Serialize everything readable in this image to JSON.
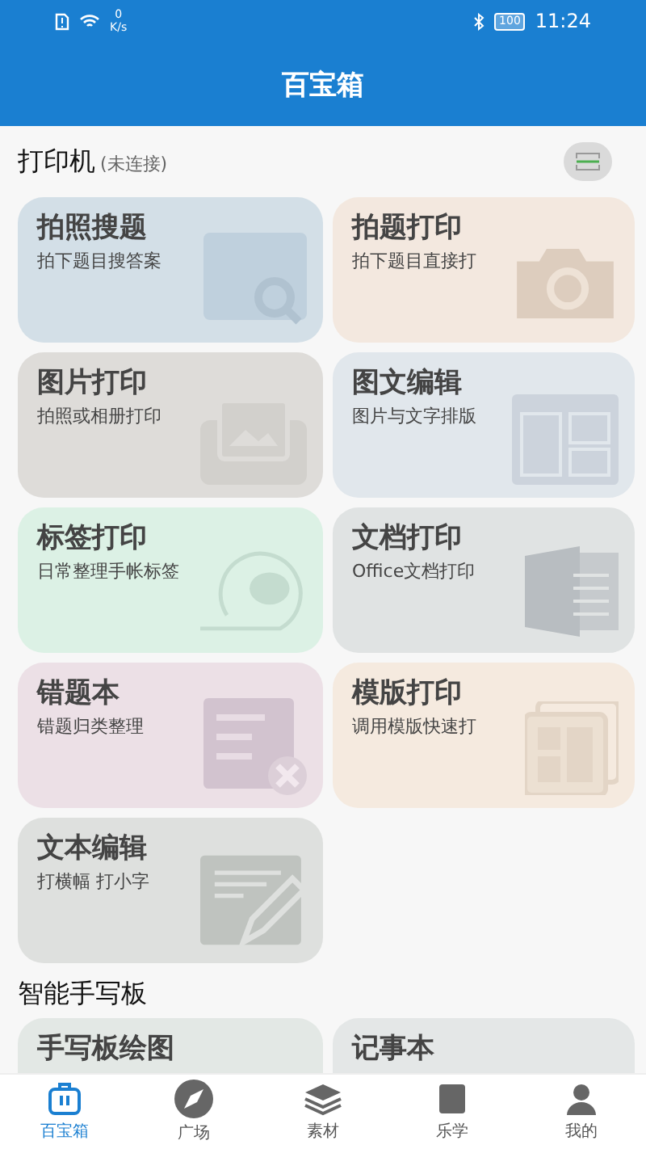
{
  "status_bar": {
    "speed_value": "0",
    "speed_unit": "K/s",
    "battery": "100",
    "time": "11:24"
  },
  "header": {
    "title": "百宝箱"
  },
  "sections": [
    {
      "title": "打印机",
      "note": "(未连接)",
      "has_printer_button": true,
      "cards": [
        {
          "title": "拍照搜题",
          "subtitle": "拍下题目搜答案",
          "color": "#d3dfe7"
        },
        {
          "title": "拍题打印",
          "subtitle": "拍下题目直接打",
          "color": "#f3e8df"
        },
        {
          "title": "图片打印",
          "subtitle": "拍照或相册打印",
          "color": "#dedcd9"
        },
        {
          "title": "图文编辑",
          "subtitle": "图片与文字排版",
          "color": "#e1e7ec"
        },
        {
          "title": "标签打印",
          "subtitle": "日常整理手帐标签",
          "color": "#dcf1e5"
        },
        {
          "title": "文档打印",
          "subtitle": "Office文档打印",
          "color": "#e0e3e3"
        },
        {
          "title": "错题本",
          "subtitle": "错题归类整理",
          "color": "#ece0e6"
        },
        {
          "title": "模版打印",
          "subtitle": "调用模版快速打",
          "color": "#f5eadf"
        },
        {
          "title": "文本编辑",
          "subtitle": "打横幅 打小字",
          "color": "#dee0de"
        }
      ]
    },
    {
      "title": "智能手写板",
      "has_printer_button": false,
      "cards": [
        {
          "title": "手写板绘图",
          "color": "#e3e8e5"
        },
        {
          "title": "记事本",
          "color": "#e4e7e7"
        }
      ]
    }
  ],
  "bottom_nav": [
    {
      "label": "百宝箱",
      "selected": true
    },
    {
      "label": "广场",
      "selected": false
    },
    {
      "label": "素材",
      "selected": false
    },
    {
      "label": "乐学",
      "selected": false
    },
    {
      "label": "我的",
      "selected": false
    }
  ]
}
